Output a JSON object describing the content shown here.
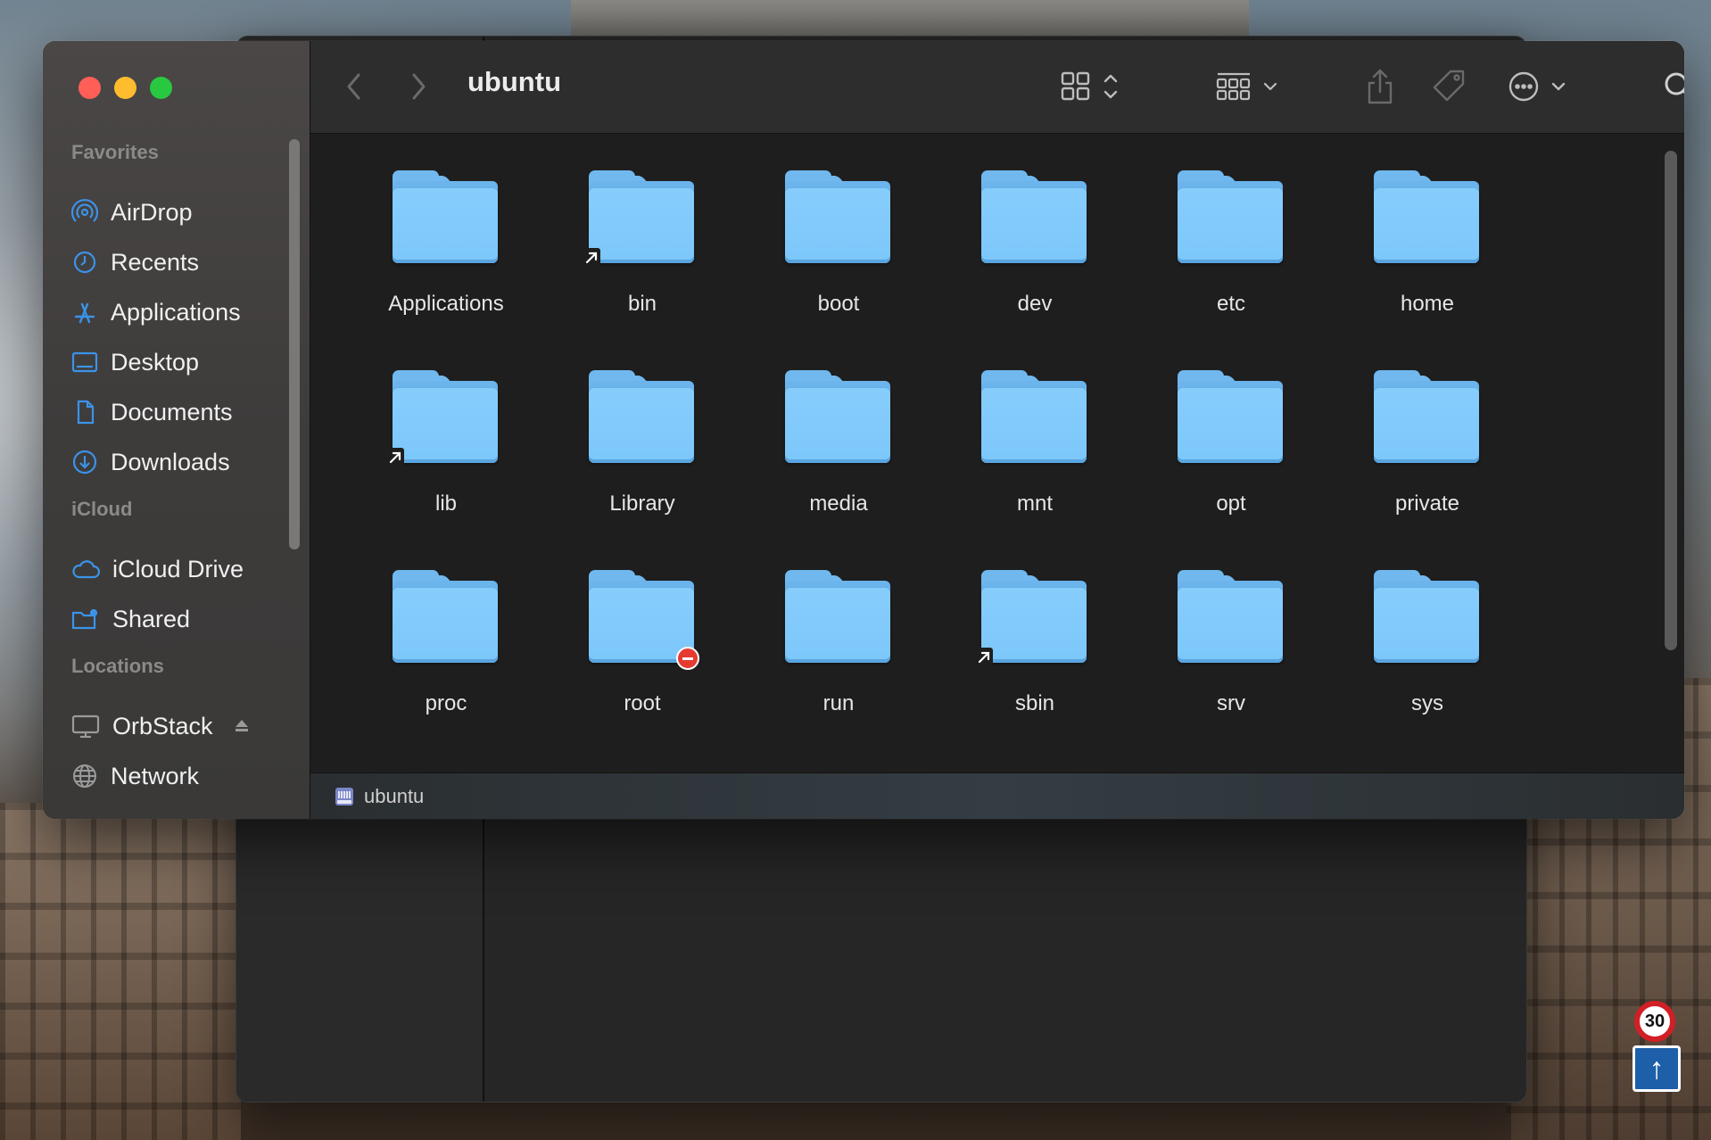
{
  "window": {
    "title": "ubuntu"
  },
  "sidebar": {
    "sections": [
      {
        "title": "Favorites",
        "items": [
          {
            "label": "AirDrop",
            "icon": "airdrop-icon"
          },
          {
            "label": "Recents",
            "icon": "clock-icon"
          },
          {
            "label": "Applications",
            "icon": "applications-icon"
          },
          {
            "label": "Desktop",
            "icon": "desktop-icon"
          },
          {
            "label": "Documents",
            "icon": "document-icon"
          },
          {
            "label": "Downloads",
            "icon": "download-icon"
          }
        ]
      },
      {
        "title": "iCloud",
        "items": [
          {
            "label": "iCloud Drive",
            "icon": "cloud-icon"
          },
          {
            "label": "Shared",
            "icon": "shared-folder-icon"
          }
        ]
      },
      {
        "title": "Locations",
        "items": [
          {
            "label": "OrbStack",
            "icon": "computer-icon",
            "ejectable": true
          },
          {
            "label": "Network",
            "icon": "globe-icon"
          }
        ]
      }
    ]
  },
  "toolbar": {
    "back": "back-chevron-icon",
    "forward": "forward-chevron-icon",
    "view_mode": "grid-view-icon",
    "group": "group-icon",
    "share": "share-icon",
    "tags": "tag-icon",
    "more": "more-icon",
    "search": "search-icon"
  },
  "folders": [
    {
      "name": "Applications"
    },
    {
      "name": "bin",
      "alias": true
    },
    {
      "name": "boot"
    },
    {
      "name": "dev"
    },
    {
      "name": "etc"
    },
    {
      "name": "home"
    },
    {
      "name": "lib",
      "alias": true
    },
    {
      "name": "Library"
    },
    {
      "name": "media"
    },
    {
      "name": "mnt"
    },
    {
      "name": "opt"
    },
    {
      "name": "private"
    },
    {
      "name": "proc"
    },
    {
      "name": "root",
      "restricted": true
    },
    {
      "name": "run"
    },
    {
      "name": "sbin",
      "alias": true
    },
    {
      "name": "srv"
    },
    {
      "name": "sys"
    }
  ],
  "statusbar": {
    "path": "ubuntu"
  },
  "colors": {
    "folder": "#7cc7fb",
    "accent": "#3b93e8",
    "close": "#ff5f57",
    "minimize": "#febc2e",
    "zoom": "#28c840"
  },
  "backdrop": {
    "sign_speed": "30",
    "sign_arrow": "↑"
  }
}
